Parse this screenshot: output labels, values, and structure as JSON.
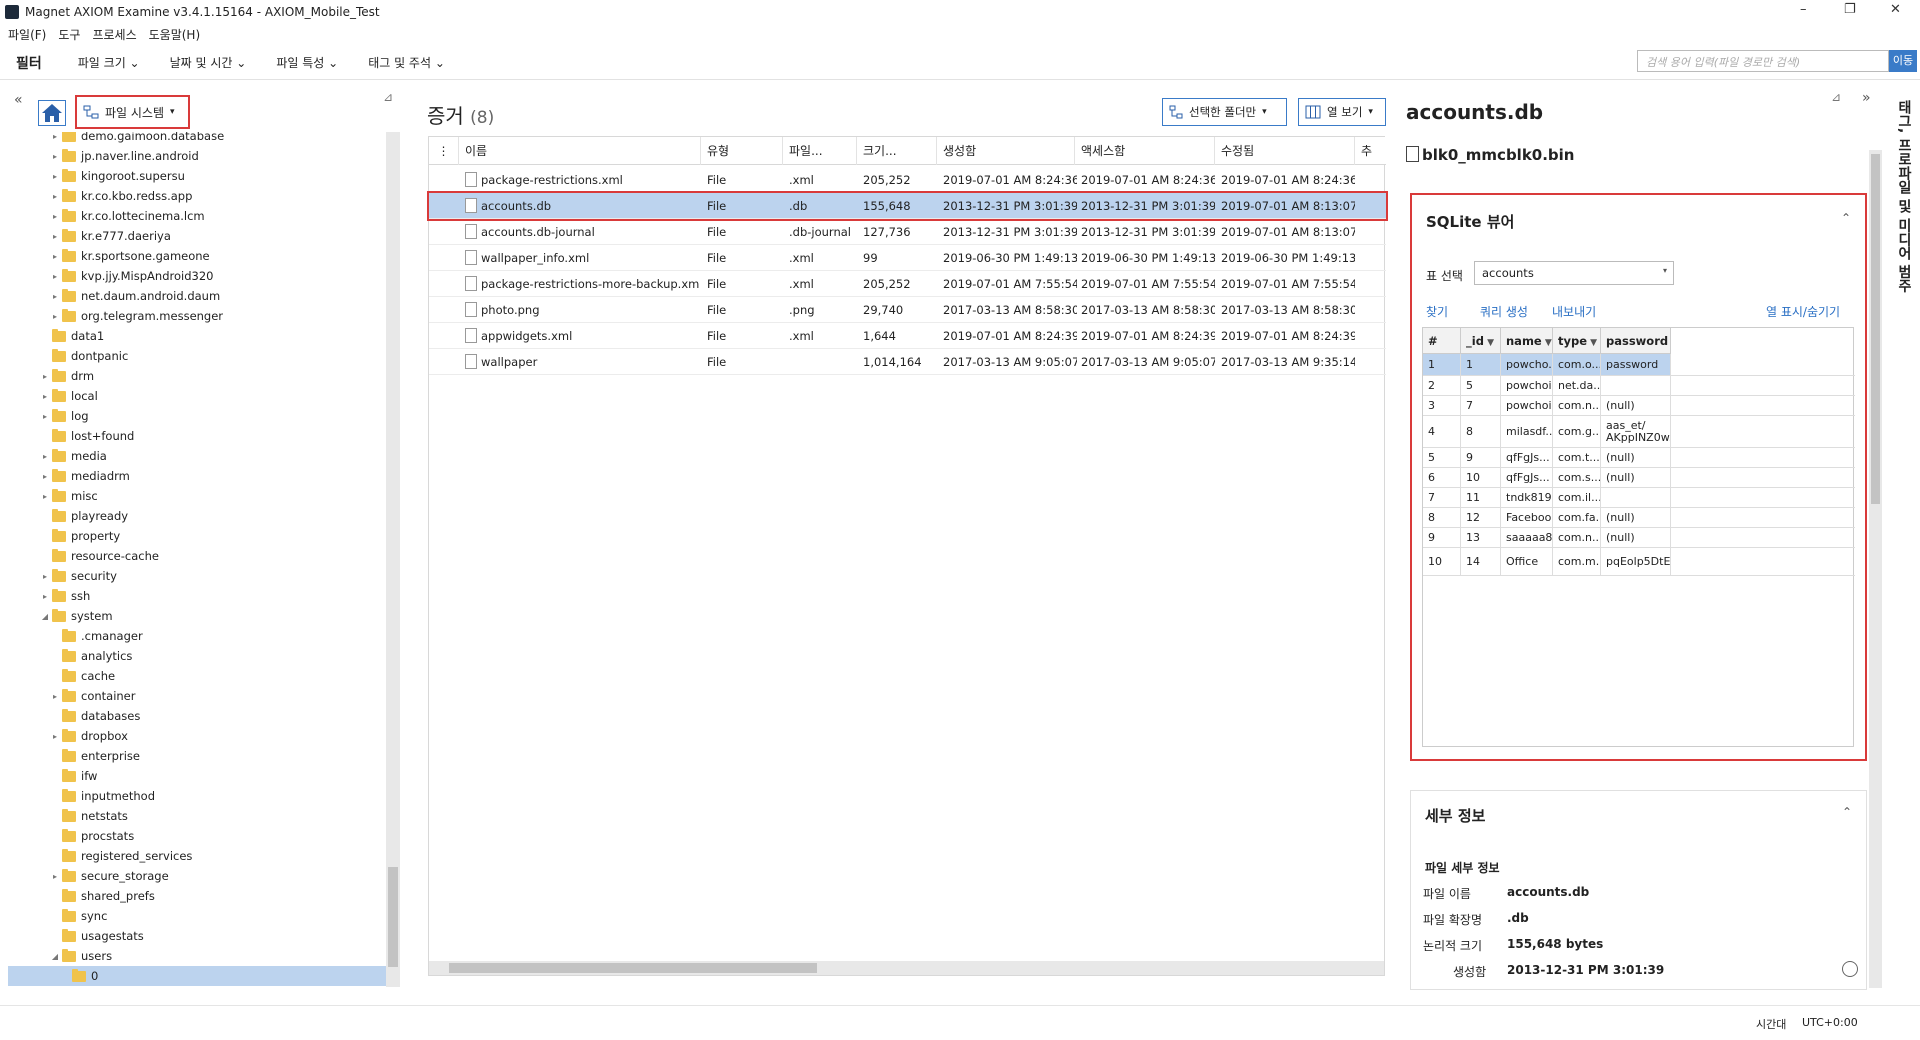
{
  "window": {
    "title": "Magnet AXIOM Examine v3.4.1.15164 - AXIOM_Mobile_Test",
    "minimize": "–",
    "restore": "❐",
    "close": "✕"
  },
  "menu": [
    "파일(F)",
    "도구",
    "프로세스",
    "도움말(H)"
  ],
  "filterbar": {
    "title": "필터",
    "items": [
      "파일 크기 ⌄",
      "날짜 및 시간 ⌄",
      "파일 특성 ⌄",
      "태그 및 주석 ⌄"
    ],
    "search_placeholder": "검색 용어 입력(파일 경로만 검색)",
    "go": "이동"
  },
  "left": {
    "collapse": "«",
    "fs_button": "파일 시스템",
    "fs_caret": "▾",
    "pin": "⊿"
  },
  "tree": [
    {
      "label": "demo.gaimoon.database",
      "depth": 2,
      "arrow": "▸"
    },
    {
      "label": "jp.naver.line.android",
      "depth": 2,
      "arrow": "▸"
    },
    {
      "label": "kingoroot.supersu",
      "depth": 2,
      "arrow": "▸"
    },
    {
      "label": "kr.co.kbo.redss.app",
      "depth": 2,
      "arrow": "▸"
    },
    {
      "label": "kr.co.lottecinema.lcm",
      "depth": 2,
      "arrow": "▸"
    },
    {
      "label": "kr.e777.daeriya",
      "depth": 2,
      "arrow": "▸"
    },
    {
      "label": "kr.sportsone.gameone",
      "depth": 2,
      "arrow": "▸"
    },
    {
      "label": "kvp.jjy.MispAndroid320",
      "depth": 2,
      "arrow": "▸"
    },
    {
      "label": "net.daum.android.daum",
      "depth": 2,
      "arrow": "▸"
    },
    {
      "label": "org.telegram.messenger",
      "depth": 2,
      "arrow": "▸"
    },
    {
      "label": "data1",
      "depth": 1,
      "arrow": ""
    },
    {
      "label": "dontpanic",
      "depth": 1,
      "arrow": ""
    },
    {
      "label": "drm",
      "depth": 1,
      "arrow": "▸"
    },
    {
      "label": "local",
      "depth": 1,
      "arrow": "▸"
    },
    {
      "label": "log",
      "depth": 1,
      "arrow": "▸"
    },
    {
      "label": "lost+found",
      "depth": 1,
      "arrow": ""
    },
    {
      "label": "media",
      "depth": 1,
      "arrow": "▸"
    },
    {
      "label": "mediadrm",
      "depth": 1,
      "arrow": "▸"
    },
    {
      "label": "misc",
      "depth": 1,
      "arrow": "▸"
    },
    {
      "label": "playready",
      "depth": 1,
      "arrow": ""
    },
    {
      "label": "property",
      "depth": 1,
      "arrow": ""
    },
    {
      "label": "resource-cache",
      "depth": 1,
      "arrow": ""
    },
    {
      "label": "security",
      "depth": 1,
      "arrow": "▸"
    },
    {
      "label": "ssh",
      "depth": 1,
      "arrow": "▸"
    },
    {
      "label": "system",
      "depth": 1,
      "arrow": "◢"
    },
    {
      "label": ".cmanager",
      "depth": 2,
      "arrow": ""
    },
    {
      "label": "analytics",
      "depth": 2,
      "arrow": ""
    },
    {
      "label": "cache",
      "depth": 2,
      "arrow": ""
    },
    {
      "label": "container",
      "depth": 2,
      "arrow": "▸"
    },
    {
      "label": "databases",
      "depth": 2,
      "arrow": ""
    },
    {
      "label": "dropbox",
      "depth": 2,
      "arrow": "▸"
    },
    {
      "label": "enterprise",
      "depth": 2,
      "arrow": ""
    },
    {
      "label": "ifw",
      "depth": 2,
      "arrow": ""
    },
    {
      "label": "inputmethod",
      "depth": 2,
      "arrow": ""
    },
    {
      "label": "netstats",
      "depth": 2,
      "arrow": ""
    },
    {
      "label": "procstats",
      "depth": 2,
      "arrow": ""
    },
    {
      "label": "registered_services",
      "depth": 2,
      "arrow": ""
    },
    {
      "label": "secure_storage",
      "depth": 2,
      "arrow": "▸"
    },
    {
      "label": "shared_prefs",
      "depth": 2,
      "arrow": ""
    },
    {
      "label": "sync",
      "depth": 2,
      "arrow": ""
    },
    {
      "label": "usagestats",
      "depth": 2,
      "arrow": ""
    },
    {
      "label": "users",
      "depth": 2,
      "arrow": "◢"
    },
    {
      "label": "0",
      "depth": 3,
      "arrow": "",
      "selected": true
    }
  ],
  "evidence": {
    "title": "증거",
    "count": "(8)",
    "folder_btn": "선택한 폴더만",
    "cols_btn": "열 보기",
    "caret": "▾",
    "columns": [
      "이름",
      "유형",
      "파일...",
      "크기...",
      "생성함",
      "액세스함",
      "수정됨",
      "추"
    ],
    "rows": [
      {
        "name": "package-restrictions.xml",
        "type": "File",
        "ext": ".xml",
        "size": "205,252",
        "created": "2019-07-01 AM 8:24:36",
        "accessed": "2019-07-01 AM 8:24:36",
        "modified": "2019-07-01 AM 8:24:36"
      },
      {
        "name": "accounts.db",
        "type": "File",
        "ext": ".db",
        "size": "155,648",
        "created": "2013-12-31 PM 3:01:39",
        "accessed": "2013-12-31 PM 3:01:39",
        "modified": "2019-07-01 AM 8:13:07",
        "selected": true
      },
      {
        "name": "accounts.db-journal",
        "type": "File",
        "ext": ".db-journal",
        "size": "127,736",
        "created": "2013-12-31 PM 3:01:39",
        "accessed": "2013-12-31 PM 3:01:39",
        "modified": "2019-07-01 AM 8:13:07"
      },
      {
        "name": "wallpaper_info.xml",
        "type": "File",
        "ext": ".xml",
        "size": "99",
        "created": "2019-06-30 PM 1:49:13",
        "accessed": "2019-06-30 PM 1:49:13",
        "modified": "2019-06-30 PM 1:49:13"
      },
      {
        "name": "package-restrictions-more-backup.xml",
        "type": "File",
        "ext": ".xml",
        "size": "205,252",
        "created": "2019-07-01 AM 7:55:54",
        "accessed": "2019-07-01 AM 7:55:54",
        "modified": "2019-07-01 AM 7:55:54"
      },
      {
        "name": "photo.png",
        "type": "File",
        "ext": ".png",
        "size": "29,740",
        "created": "2017-03-13 AM 8:58:30",
        "accessed": "2017-03-13 AM 8:58:30",
        "modified": "2017-03-13 AM 8:58:30"
      },
      {
        "name": "appwidgets.xml",
        "type": "File",
        "ext": ".xml",
        "size": "1,644",
        "created": "2019-07-01 AM 8:24:39",
        "accessed": "2019-07-01 AM 8:24:39",
        "modified": "2019-07-01 AM 8:24:39"
      },
      {
        "name": "wallpaper",
        "type": "File",
        "ext": "",
        "size": "1,014,164",
        "created": "2017-03-13 AM 9:05:07",
        "accessed": "2017-03-13 AM 9:05:07",
        "modified": "2017-03-13 AM 9:35:14"
      }
    ]
  },
  "right": {
    "title": "accounts.db",
    "subtitle": "blk0_mmcblk0.bin",
    "expand": "»",
    "sqlite": {
      "header": "SQLite 뷰어",
      "table_label": "표 선택",
      "table_value": "accounts",
      "links": [
        "찾기",
        "쿼리 생성",
        "내보내기"
      ],
      "toggle_cols": "열 표시/숨기기",
      "collapse": "⌃",
      "columns": [
        "#",
        "_id",
        "name",
        "type",
        "password"
      ],
      "rows": [
        {
          "n": "1",
          "id": "1",
          "name": "powcho...",
          "type": "com.o...",
          "password": "password",
          "selected": true
        },
        {
          "n": "2",
          "id": "5",
          "name": "powchoi",
          "type": "net.da...",
          "password": ""
        },
        {
          "n": "3",
          "id": "7",
          "name": "powchoi",
          "type": "com.n...",
          "password": "(null)"
        },
        {
          "n": "4",
          "id": "8",
          "name": "milasdf...",
          "type": "com.g...",
          "password": "aas_et/ AKppINZ0w..."
        },
        {
          "n": "5",
          "id": "9",
          "name": "qfFgJs...",
          "type": "com.t...",
          "password": "(null)"
        },
        {
          "n": "6",
          "id": "10",
          "name": "qfFgJs...",
          "type": "com.s...",
          "password": "(null)"
        },
        {
          "n": "7",
          "id": "11",
          "name": "tndk819",
          "type": "com.il...",
          "password": ""
        },
        {
          "n": "8",
          "id": "12",
          "name": "Facebook",
          "type": "com.fa...",
          "password": "(null)"
        },
        {
          "n": "9",
          "id": "13",
          "name": "saaaaa8...",
          "type": "com.n...",
          "password": "(null)"
        },
        {
          "n": "10",
          "id": "14",
          "name": "Office",
          "type": "com.m...",
          "password": "pqEolp5DtE..."
        }
      ]
    },
    "details": {
      "header": "세부 정보",
      "section": "파일 세부 정보",
      "fields": [
        {
          "label": "파일 이름",
          "value": "accounts.db"
        },
        {
          "label": "파일 확장명",
          "value": ".db"
        },
        {
          "label": "논리적 크기",
          "value": "155,648 bytes"
        },
        {
          "label": "생성함",
          "value": "2013-12-31 PM 3:01:39"
        }
      ]
    },
    "vertical_tab": "태그, 프로파일 및 미디어 범주"
  },
  "status": {
    "timezone_label": "시간대",
    "timezone_value": "UTC+0:00"
  },
  "colors": {
    "accent": "#3a7bc8",
    "highlight_border": "#d93a3a",
    "selection": "#bcd3ee"
  }
}
